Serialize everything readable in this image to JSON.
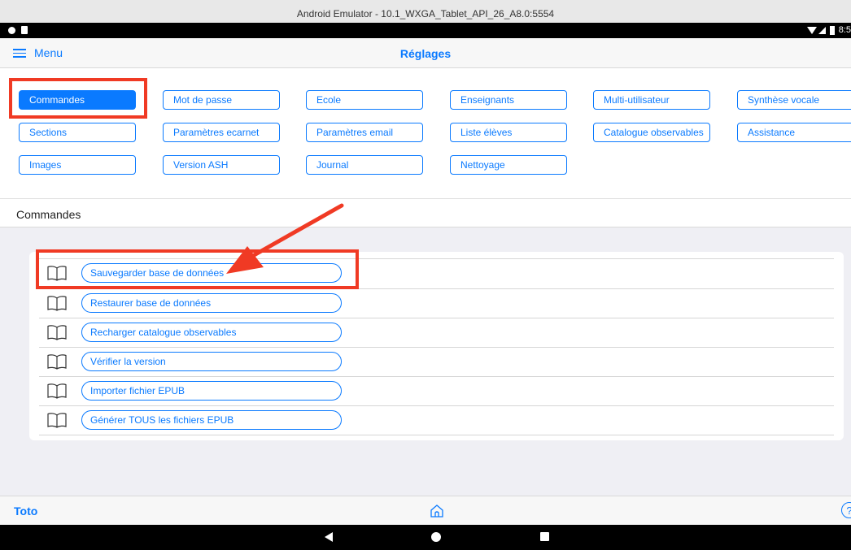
{
  "window": {
    "title": "Android Emulator - 10.1_WXGA_Tablet_API_26_A8.0:5554"
  },
  "status_bar": {
    "time": "8:5"
  },
  "header": {
    "menu_label": "Menu",
    "title": "Réglages"
  },
  "tabs": [
    {
      "label": "Commandes",
      "active": true
    },
    {
      "label": "Mot de passe"
    },
    {
      "label": "Ecole"
    },
    {
      "label": "Enseignants"
    },
    {
      "label": "Multi-utilisateur"
    },
    {
      "label": "Synthèse vocale"
    },
    {
      "label": "Sections"
    },
    {
      "label": "Paramètres ecarnet"
    },
    {
      "label": "Paramètres email"
    },
    {
      "label": "Liste élèves"
    },
    {
      "label": "Catalogue observables"
    },
    {
      "label": "Assistance"
    },
    {
      "label": "Images"
    },
    {
      "label": "Version ASH"
    },
    {
      "label": "Journal"
    },
    {
      "label": "Nettoyage"
    }
  ],
  "section": {
    "title": "Commandes"
  },
  "commands": [
    {
      "label": "Sauvegarder base de données"
    },
    {
      "label": "Restaurer base de données"
    },
    {
      "label": "Recharger catalogue observables"
    },
    {
      "label": "Vérifier la version"
    },
    {
      "label": "Importer fichier EPUB"
    },
    {
      "label": "Générer TOUS les fichiers EPUB"
    }
  ],
  "footer": {
    "user": "Toto",
    "help_symbol": "?"
  },
  "colors": {
    "accent": "#0a7aff",
    "annotation": "#f03a24"
  }
}
